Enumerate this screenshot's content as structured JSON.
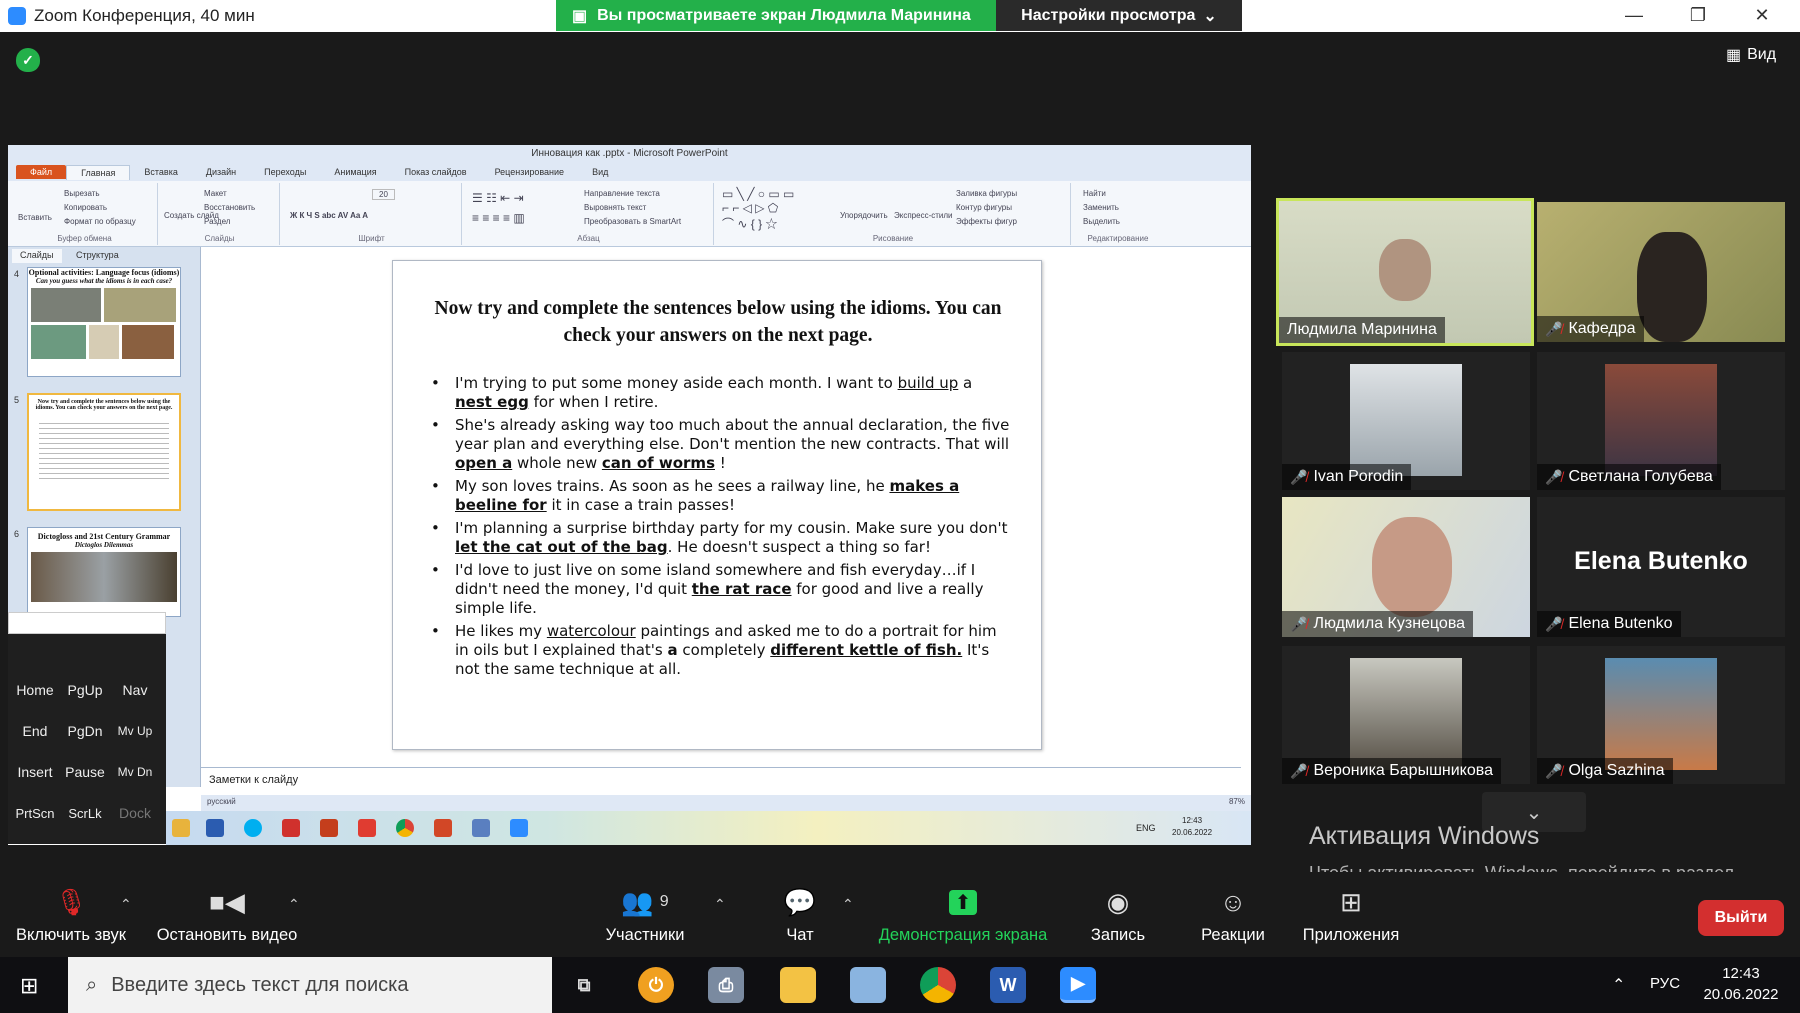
{
  "window": {
    "title": "Zoom Конференция, 40 мин",
    "share_banner": "Вы просматриваете экран Людмила Маринина",
    "view_settings": "Настройки просмотра",
    "view_button": "Вид"
  },
  "ppt": {
    "title": "Инновация как .pptx - Microsoft PowerPoint",
    "tabs": [
      "Файл",
      "Главная",
      "Вставка",
      "Дизайн",
      "Переходы",
      "Анимация",
      "Показ слайдов",
      "Рецензирование",
      "Вид"
    ],
    "ribbon": {
      "clipboard": {
        "label": "Буфер обмена",
        "paste": "Вставить",
        "cut": "Вырезать",
        "copy": "Копировать",
        "format": "Формат по образцу"
      },
      "slides": {
        "label": "Слайды",
        "create": "Создать слайд",
        "layout": "Макет",
        "reset": "Восстановить",
        "section": "Раздел"
      },
      "font": {
        "label": "Шрифт",
        "size": "20"
      },
      "paragraph": {
        "label": "Абзац",
        "direction": "Направление текста",
        "align": "Выровнять текст",
        "smartart": "Преобразовать в SmartArt"
      },
      "drawing": {
        "label": "Рисование",
        "arrange": "Упорядочить",
        "styles": "Экспресс-стили",
        "fill": "Заливка фигуры",
        "outline": "Контур фигуры",
        "effects": "Эффекты фигур"
      },
      "editing": {
        "label": "Редактирование",
        "find": "Найти",
        "replace": "Заменить",
        "select": "Выделить"
      }
    },
    "panel_tabs": [
      "Слайды",
      "Структура"
    ],
    "thumbs": [
      {
        "num": "4",
        "title": "Optional activities: Language focus (idioms)",
        "subtitle": "Can you guess what the idioms is in each case?"
      },
      {
        "num": "5",
        "title": "Now try and complete the sentences below using the idioms. You can check your answers on the next page."
      },
      {
        "num": "6",
        "title": "Dictogloss and 21st Century Grammar",
        "subtitle": "Dictoglos Dilemmas"
      }
    ],
    "slide_title": "Now try and complete the sentences below using the idioms.  You can check your answers on the next page.",
    "bullets": [
      [
        {
          "t": "I'm trying to put some money aside each month. I want to "
        },
        {
          "t": "build up",
          "u": true
        },
        {
          "t": " a "
        },
        {
          "t": "nest egg",
          "b": true
        },
        {
          "t": " for when I retire."
        }
      ],
      [
        {
          "t": "She's already asking way too much about the annual declaration, the five year plan and everything else. Don't mention the new contracts. That will "
        },
        {
          "t": "open a",
          "b": true
        },
        {
          "t": " whole new "
        },
        {
          "t": "can of worms",
          "b": true
        },
        {
          "t": " !"
        }
      ],
      [
        {
          "t": "My son loves trains. As soon as he sees a railway line, he "
        },
        {
          "t": "makes a beeline for",
          "b": true
        },
        {
          "t": " it in case a train passes!"
        }
      ],
      [
        {
          "t": "I'm planning a surprise birthday party for my cousin. Make sure you don't "
        },
        {
          "t": "let the cat out of the bag",
          "b": true
        },
        {
          "t": ".  He doesn't suspect a thing so far!"
        }
      ],
      [
        {
          "t": "I'd love to just live on some island somewhere and fish everyday…if I didn't need the money, I'd quit "
        },
        {
          "t": "the rat race",
          "b": true
        },
        {
          "t": " for good and live a really simple life."
        }
      ],
      [
        {
          "t": " He likes my "
        },
        {
          "t": "watercolour",
          "u": true
        },
        {
          "t": " paintings and asked me to do a portrait for him in oils but I explained that's "
        },
        {
          "t": "a",
          "b2": true
        },
        {
          "t": " completely "
        },
        {
          "t": "different kettle of fish.",
          "b": true
        },
        {
          "t": "  It's not the same technique at all."
        }
      ]
    ],
    "notes_placeholder": "Заметки к слайду",
    "status_lang": "русский",
    "zoom": "87%",
    "tray": {
      "lang": "ENG",
      "time": "12:43",
      "date": "20.06.2022"
    }
  },
  "osk": {
    "keys": [
      "Home",
      "PgUp",
      "Nav",
      "End",
      "PgDn",
      "Mv Up",
      "Insert",
      "Pause",
      "Mv Dn",
      "PrtScn",
      "ScrLk",
      "Dock"
    ]
  },
  "participants": [
    {
      "name": "Людмила Маринина",
      "muted": false
    },
    {
      "name": "Кафедра",
      "muted": true
    },
    {
      "name": "Ivan Porodin",
      "muted": true
    },
    {
      "name": "Светлана Голубева",
      "muted": true
    },
    {
      "name": "Людмила Кузнецова",
      "muted": true
    },
    {
      "name": "Elena Butenko",
      "muted": true,
      "big": "Elena Butenko"
    },
    {
      "name": "Вероника Барышникова",
      "muted": true
    },
    {
      "name": "Olga Sazhina",
      "muted": true
    }
  ],
  "activation": {
    "title": "Активация Windows",
    "text": "Чтобы активировать Windows, перейдите в раздел \"Параметры\"."
  },
  "toolbar": {
    "unmute": "Включить звук",
    "stop_video": "Остановить видео",
    "participants": "Участники",
    "participants_count": "9",
    "chat": "Чат",
    "share": "Демонстрация экрана",
    "record": "Запись",
    "reactions": "Реакции",
    "apps": "Приложения",
    "leave": "Выйти"
  },
  "taskbar": {
    "search_placeholder": "Введите здесь текст для поиска",
    "lang": "РУС",
    "time": "12:43",
    "date": "20.06.2022"
  },
  "colors": {
    "zoom_green": "#23b04a",
    "leave_red": "#d32f2f",
    "active_speaker": "#c8e65a"
  }
}
